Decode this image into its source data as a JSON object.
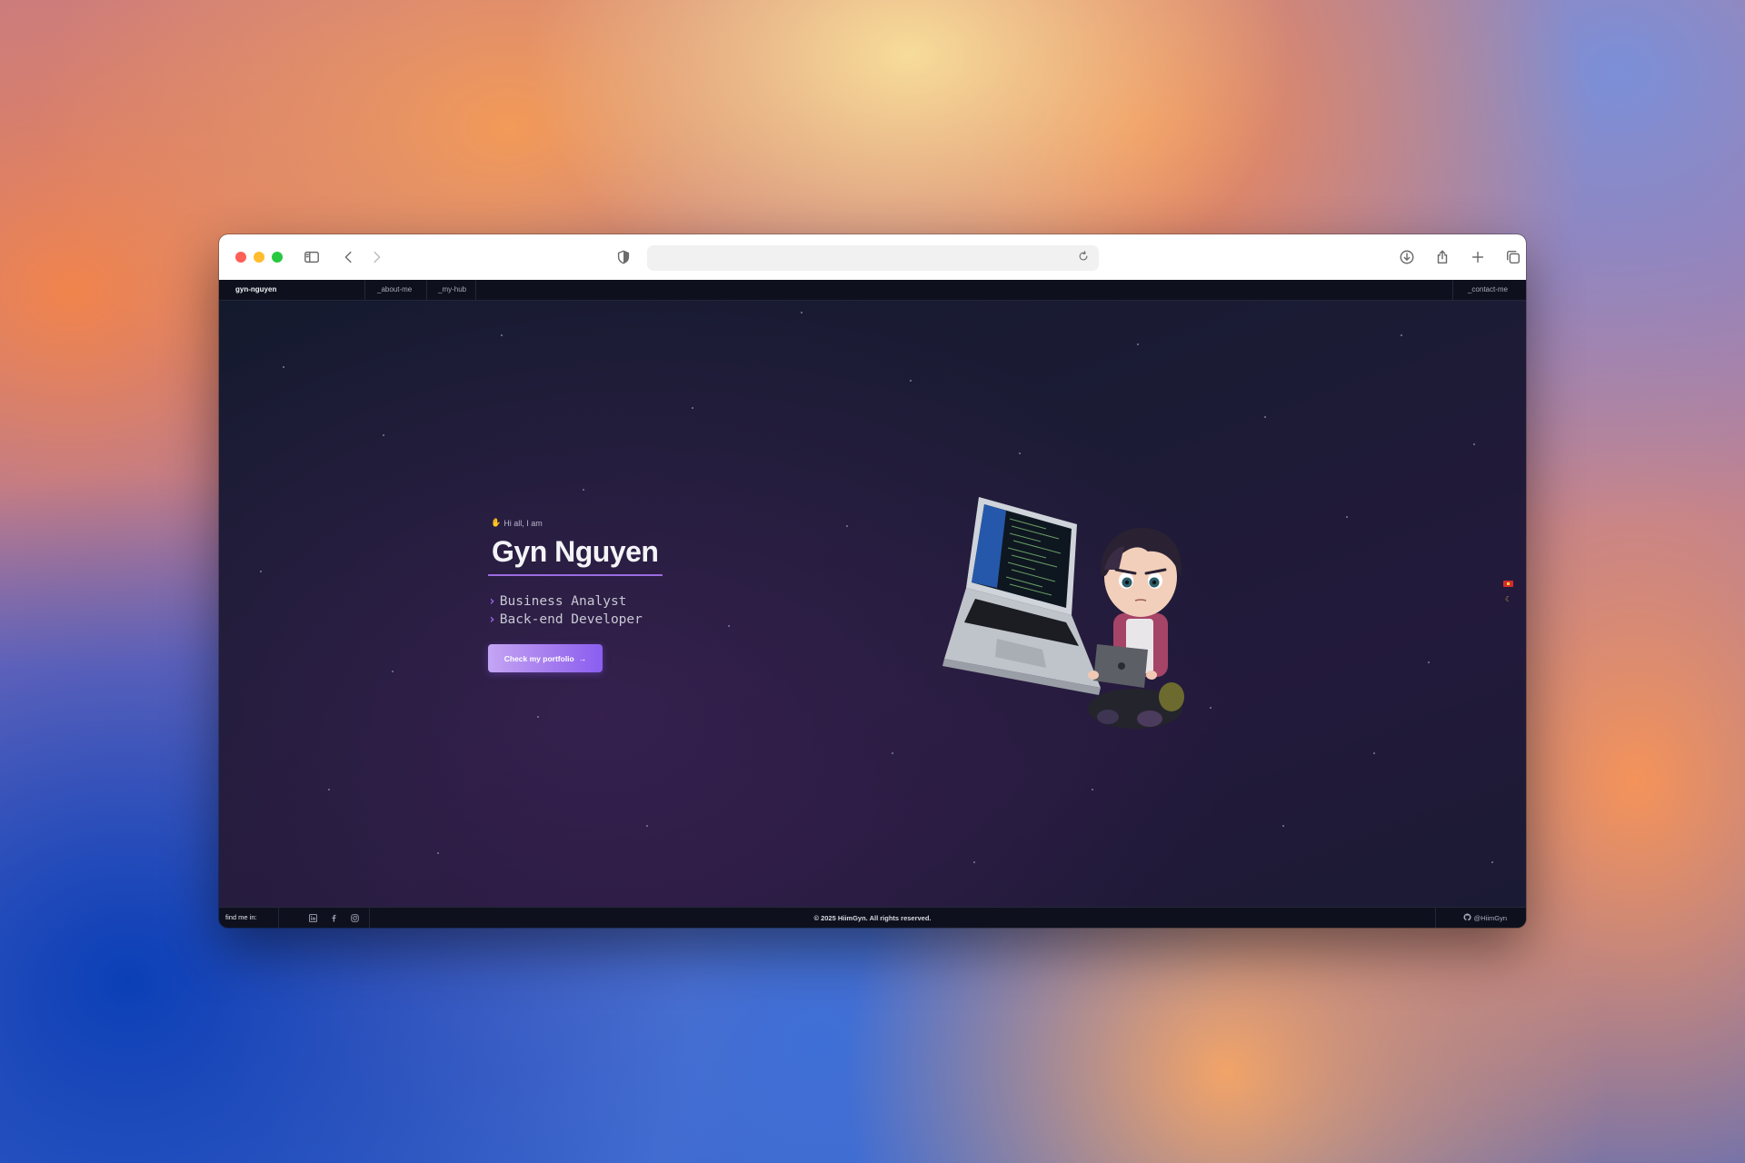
{
  "browser": {
    "address_text": "",
    "icons": {
      "sidebar": "sidebar-icon",
      "back": "chevron-left-icon",
      "forward": "chevron-right-icon",
      "privacy": "shield-icon",
      "reload": "reload-icon",
      "download": "download-icon",
      "share": "share-icon",
      "new_tab": "plus-icon",
      "tabs": "tabs-overview-icon"
    }
  },
  "nav": {
    "brand": "gyn-nguyen",
    "about": "_about-me",
    "hub": "_my-hub",
    "contact": "_contact-me"
  },
  "hero": {
    "greeting": "Hi all, I am",
    "name": "Gyn Nguyen",
    "roles": [
      "Business Analyst",
      "Back-end Developer"
    ],
    "cta_label": "Check my portfolio",
    "cta_arrow": "→"
  },
  "footer": {
    "find_me": "find me in:",
    "copyright": "© 2025 HiimGyn. All rights reserved.",
    "github_handle": "@HiimGyn",
    "socials": [
      "linkedin-icon",
      "facebook-icon",
      "instagram-icon"
    ]
  },
  "colors": {
    "accent": "#9c6be0",
    "cta_start": "#c4a5f4",
    "cta_end": "#8a5ef0",
    "page_bg": "#1b1b34",
    "nav_bg": "#0e111d"
  }
}
